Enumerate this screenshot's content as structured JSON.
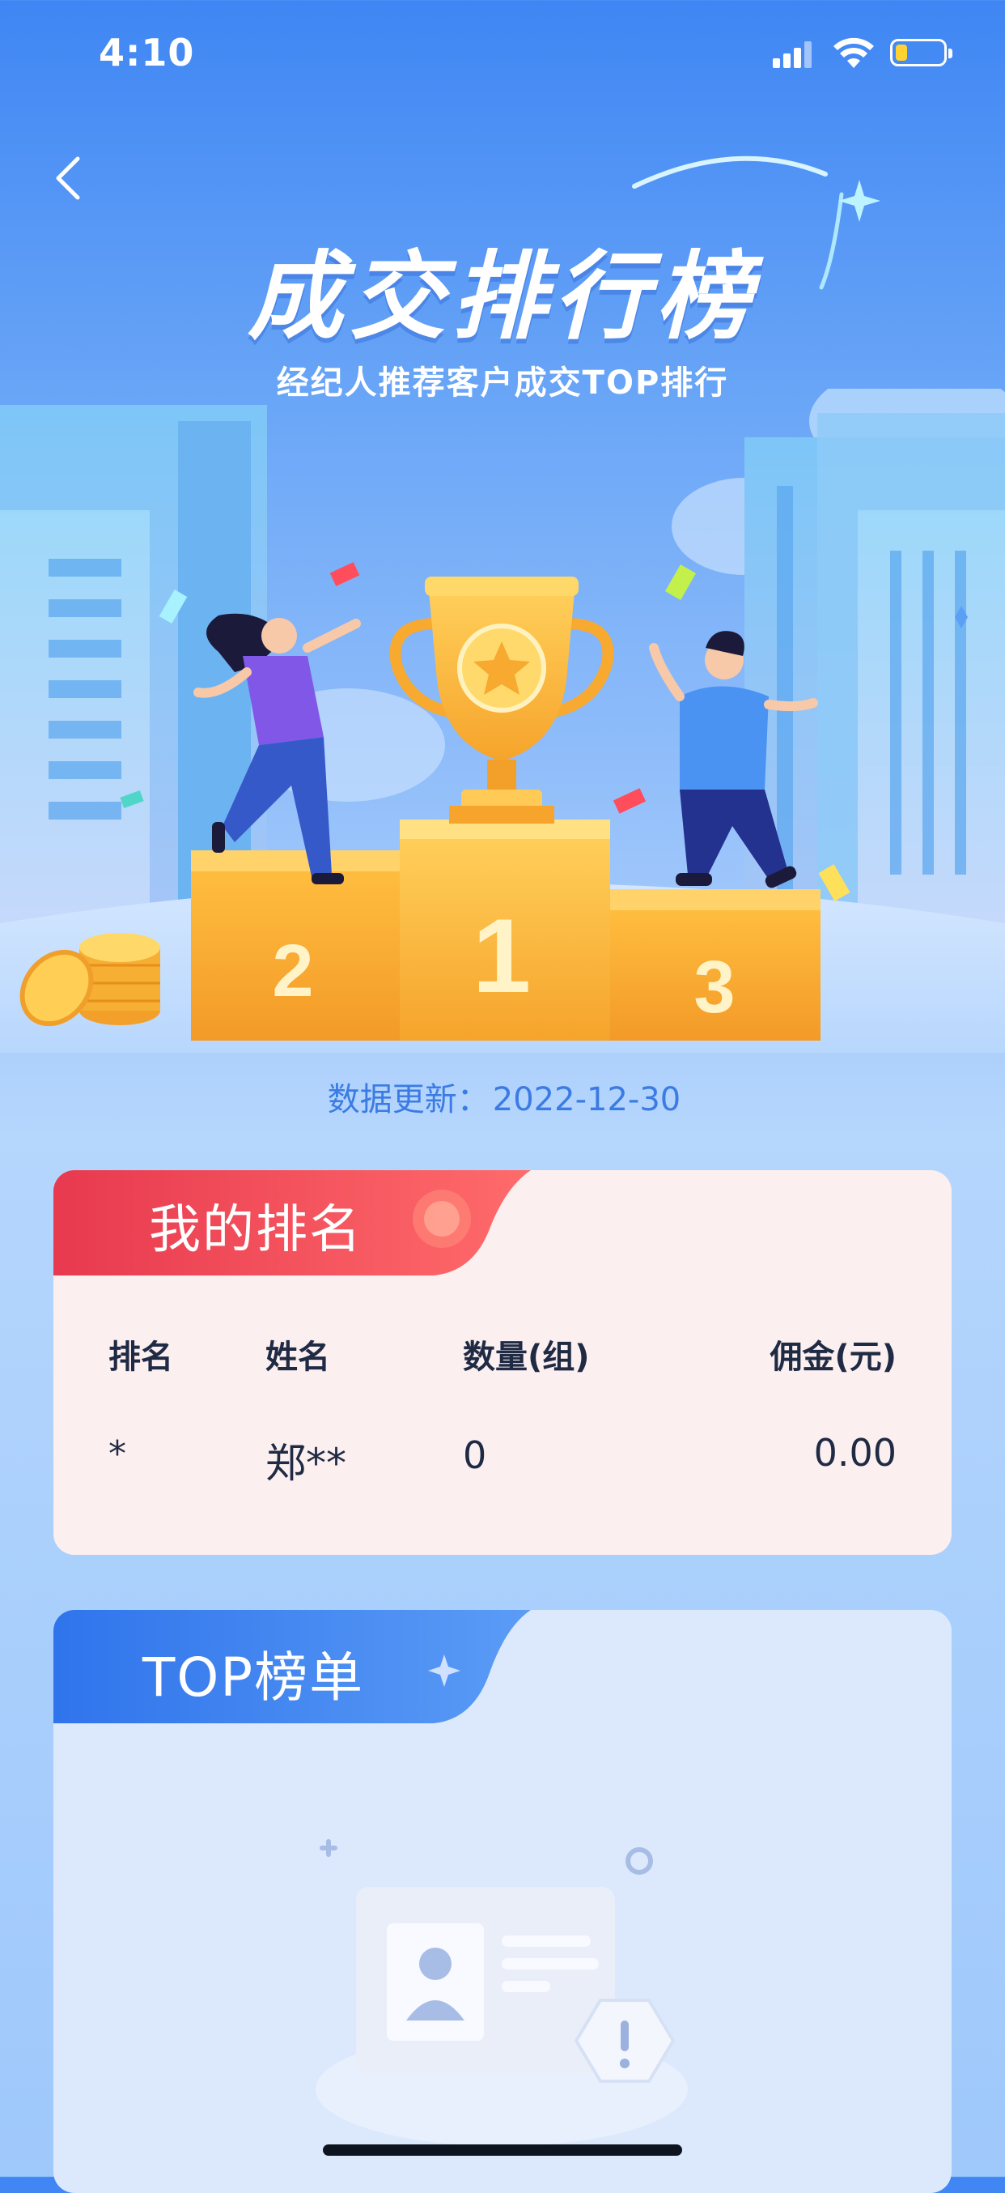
{
  "status_bar": {
    "time": "4:10"
  },
  "hero": {
    "title": "成交排行榜",
    "subtitle": "经纪人推荐客户成交TOP排行",
    "podium": [
      "2",
      "1",
      "3"
    ]
  },
  "update": {
    "label": "数据更新：",
    "date": "2022-12-30"
  },
  "my_rank": {
    "title": "我的排名",
    "columns": [
      "排名",
      "姓名",
      "数量(组)",
      "佣金(元)"
    ],
    "row": {
      "rank": "*",
      "name": "郑**",
      "count": "0",
      "commission": "0.00"
    }
  },
  "top_list": {
    "title": "TOP榜单"
  },
  "colors": {
    "accent_blue": "#3f86f4",
    "accent_red": "#e8394f",
    "text_dark": "#1f2a44",
    "update_text": "#3b7be3"
  }
}
